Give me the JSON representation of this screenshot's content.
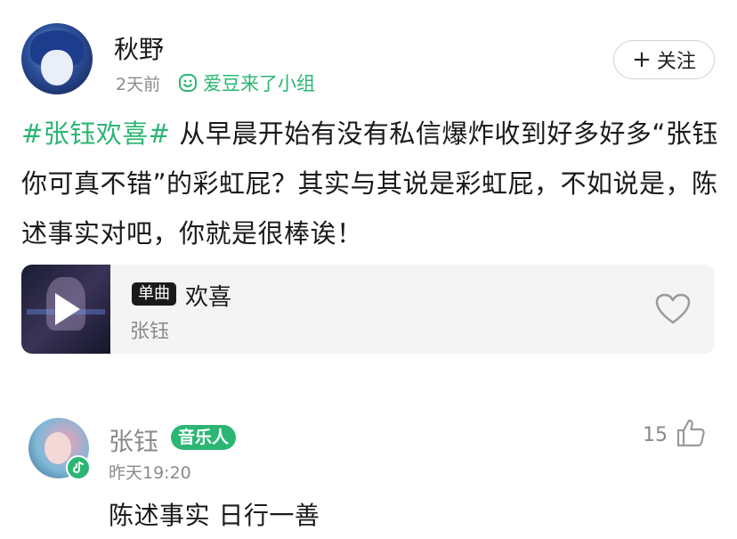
{
  "post": {
    "author": "秋野",
    "time": "2天前",
    "group": "爱豆来了小组",
    "follow_label": "关注",
    "hashtag": "#张钰欢喜#",
    "body": " 从早晨开始有没有私信爆炸收到好多好多“张钰你可真不错”的彩虹屁？其实与其说是彩虹屁，不如说是，陈述事实对吧，你就是很棒诶！"
  },
  "music_card": {
    "badge": "单曲",
    "title": "欢喜",
    "artist": "张钰"
  },
  "comment": {
    "name": "张钰",
    "badge": "音乐人",
    "time": "昨天19:20",
    "likes": "15",
    "text": "陈述事实 日行一善"
  },
  "colors": {
    "accent": "#2bb673",
    "muted": "#8a8a8a",
    "card_bg": "#f4f4f4"
  }
}
